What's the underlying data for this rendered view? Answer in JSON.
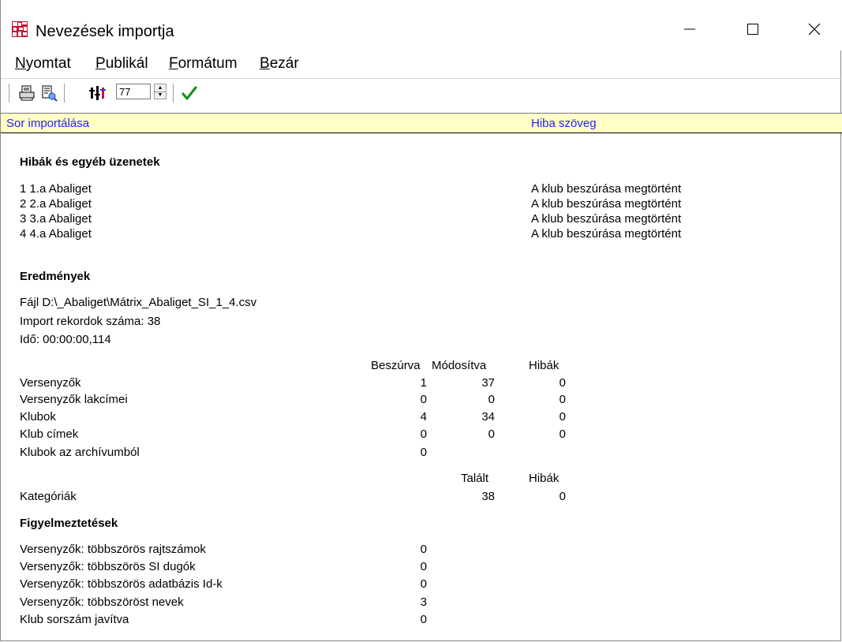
{
  "window": {
    "title": "Nevezések importja"
  },
  "menu": [
    {
      "hotkey": "N",
      "rest": "yomtat"
    },
    {
      "hotkey": "P",
      "rest": "ublikál"
    },
    {
      "hotkey": "F",
      "rest": "ormátum"
    },
    {
      "hotkey": "B",
      "rest": "ezár"
    }
  ],
  "toolbar": {
    "zoom_value": "77",
    "icons": [
      "print-icon",
      "print-preview-icon",
      "settings-icon",
      "checkmark-icon"
    ]
  },
  "columns": {
    "left": "Sor importálása",
    "right": "Hiba szöveg"
  },
  "errors": {
    "title": "Hibák és egyéb üzenetek",
    "rows": [
      {
        "row": "1 1.a Abaliget",
        "message": "A klub beszúrása megtörtént"
      },
      {
        "row": "2 2.a Abaliget",
        "message": "A klub beszúrása megtörtént"
      },
      {
        "row": "3 3.a Abaliget",
        "message": "A klub beszúrása megtörtént"
      },
      {
        "row": "4 4.a Abaliget",
        "message": "A klub beszúrása megtörtént"
      }
    ]
  },
  "results": {
    "title": "Eredmények",
    "file": "Fájl D:\\_Abaliget\\Mátrix_Abaliget_SI_1_4.csv",
    "record_count": "Import rekordok száma: 38",
    "time": "Idő: 00:00:00,114",
    "table_headers": [
      "Beszúrva",
      "Módosítva",
      "Hibák"
    ],
    "table_rows": [
      {
        "label": "Versenyzők",
        "inserted": "1",
        "modified": "37",
        "errors": "0"
      },
      {
        "label": "Versenyzők lakcímei",
        "inserted": "0",
        "modified": "0",
        "errors": "0"
      },
      {
        "label": "Klubok",
        "inserted": "4",
        "modified": "34",
        "errors": "0"
      },
      {
        "label": "Klub címek",
        "inserted": "0",
        "modified": "0",
        "errors": "0"
      },
      {
        "label": "Klubok az archívumból",
        "inserted": "0",
        "modified": "",
        "errors": ""
      }
    ],
    "category_headers": [
      "Talált",
      "Hibák"
    ],
    "category_row": {
      "label": "Kategóriák",
      "found": "38",
      "errors": "0"
    }
  },
  "warnings": {
    "title": "Figyelmeztetések",
    "rows": [
      {
        "label": "Versenyzők: többszörös rajtszámok",
        "value": "0"
      },
      {
        "label": "Versenyzők: többszörös SI dugók",
        "value": "0"
      },
      {
        "label": "Versenyzők: többszörös adatbázis Id-k",
        "value": "0"
      },
      {
        "label": "Versenyzők: többszöröst nevek",
        "value": "3"
      },
      {
        "label": "Klub sorszám javítva",
        "value": "0"
      }
    ]
  }
}
